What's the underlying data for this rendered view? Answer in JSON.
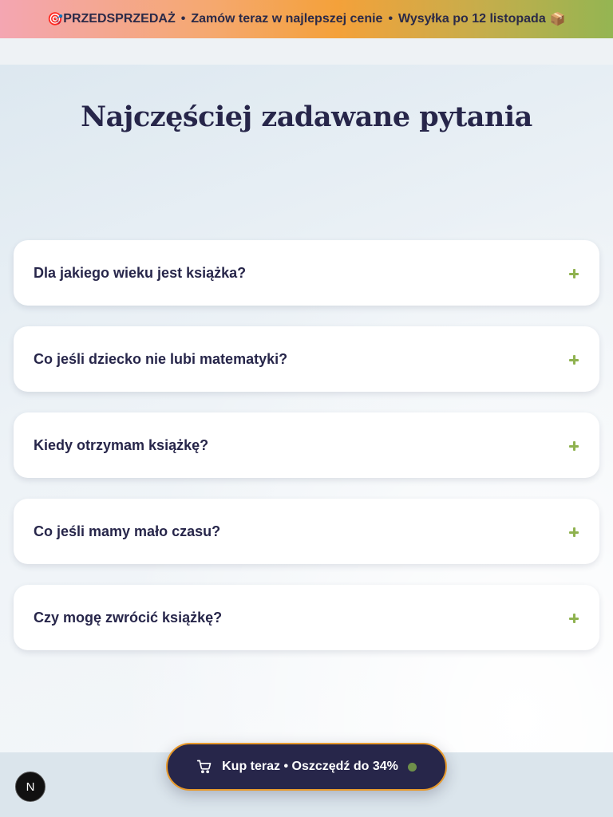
{
  "promo": {
    "icon_left": "🎯",
    "segments": [
      "PRZEDSPRZEDAŻ",
      "Zamów teraz w najlepszej cenie",
      "Wysyłka po 12 listopada"
    ],
    "separator": "•",
    "icon_right": "📦"
  },
  "faq": {
    "title": "Najczęściej zadawane pytania",
    "items": [
      {
        "question": "Dla jakiego wieku jest książka?",
        "icon": "plus-icon"
      },
      {
        "question": "Co jeśli dziecko nie lubi matematyki?",
        "icon": "plus-icon"
      },
      {
        "question": "Kiedy otrzymam książkę?",
        "icon": "plus-icon"
      },
      {
        "question": "Co jeśli mamy mało czasu?",
        "icon": "plus-icon"
      },
      {
        "question": "Czy mogę zwrócić książkę?",
        "icon": "plus-icon"
      }
    ]
  },
  "cta": {
    "icon": "cart-icon",
    "label": "Kup teraz • Oszczędź do 34%"
  },
  "badge": {
    "label": "N"
  },
  "colors": {
    "dark": "#27264a",
    "accent_green": "#8fb24f",
    "accent_orange": "#e89a2c"
  }
}
